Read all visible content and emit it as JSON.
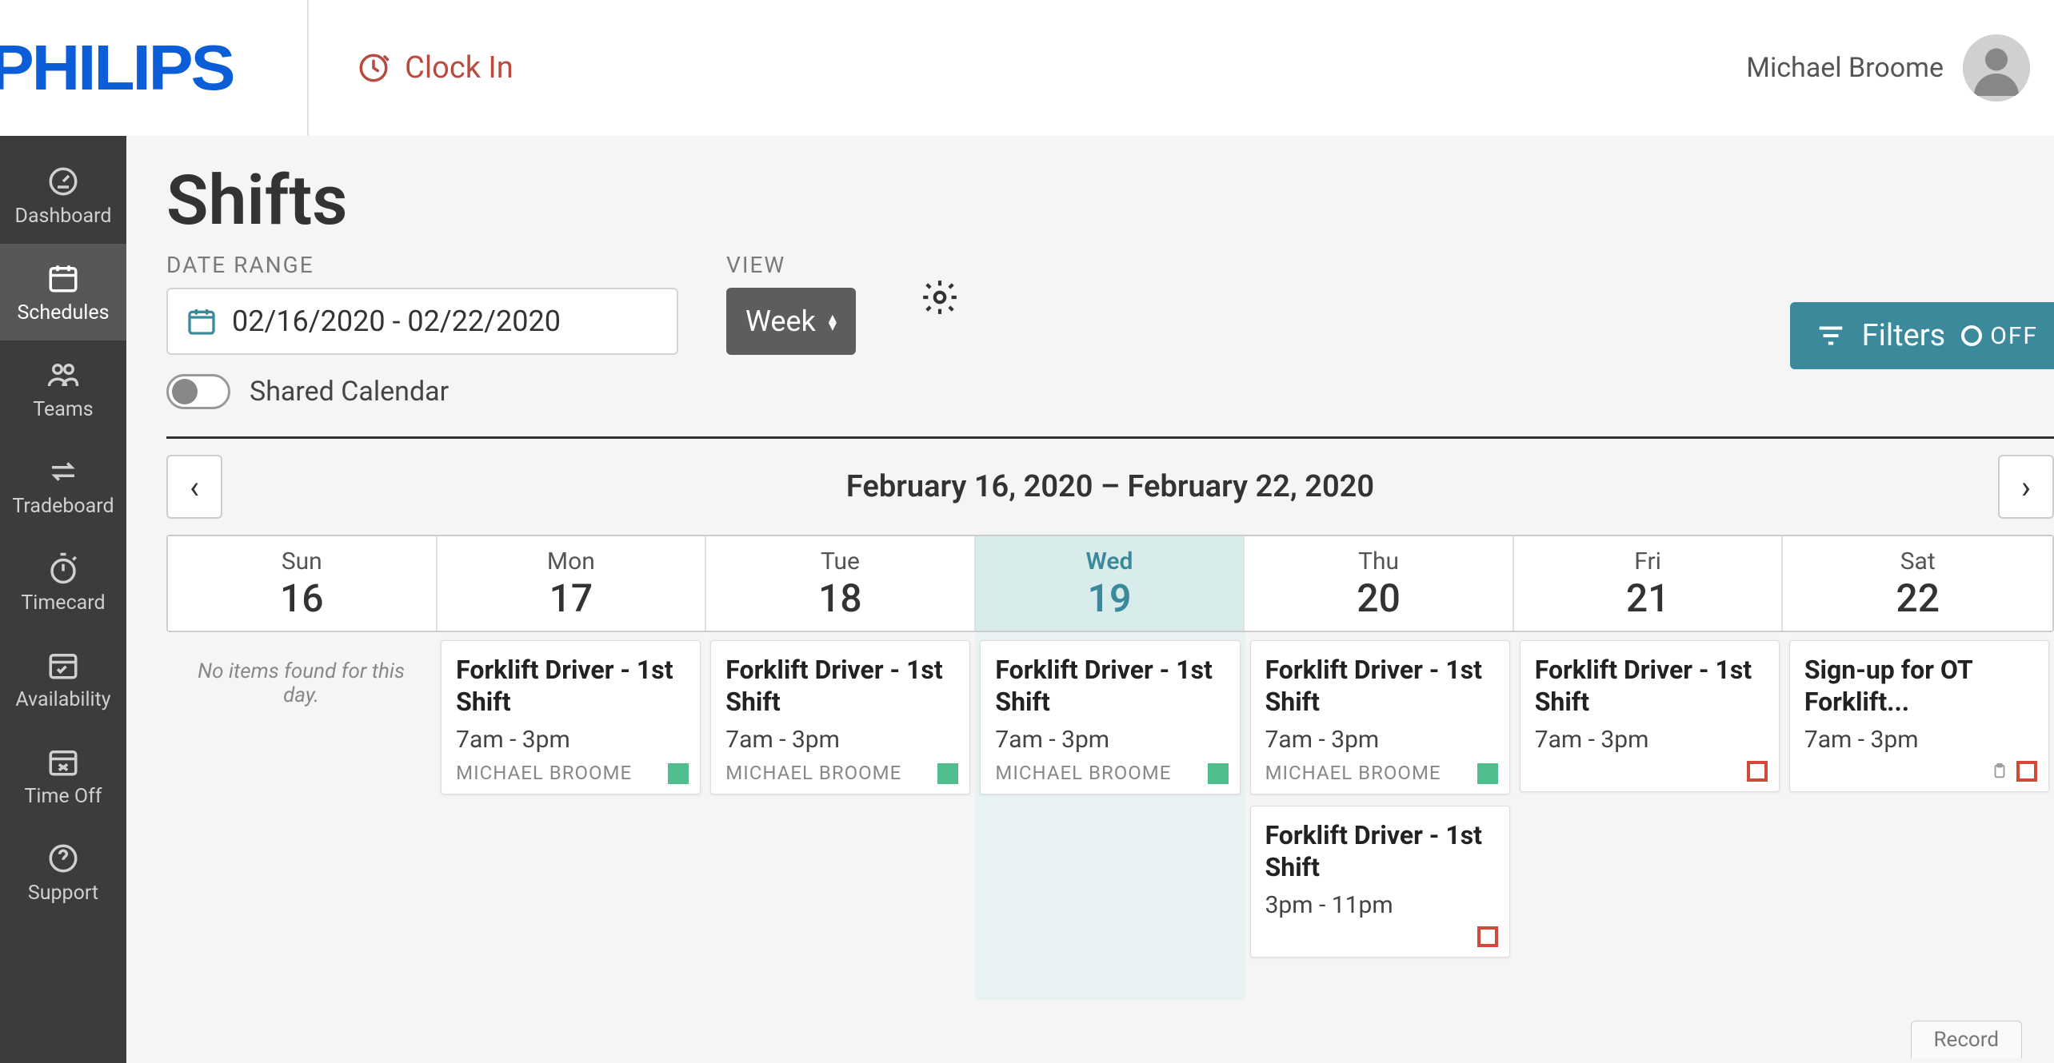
{
  "brand": "PHILIPS",
  "clock_in_label": "Clock In",
  "user_name": "Michael Broome",
  "sidebar": {
    "items": [
      {
        "id": "dashboard",
        "label": "Dashboard",
        "icon": "gauge"
      },
      {
        "id": "schedules",
        "label": "Schedules",
        "icon": "calendar",
        "active": true
      },
      {
        "id": "teams",
        "label": "Teams",
        "icon": "people"
      },
      {
        "id": "tradeboard",
        "label": "Tradeboard",
        "icon": "swap"
      },
      {
        "id": "timecard",
        "label": "Timecard",
        "icon": "stopwatch"
      },
      {
        "id": "availability",
        "label": "Availability",
        "icon": "cal-check"
      },
      {
        "id": "timeoff",
        "label": "Time Off",
        "icon": "cal-x"
      },
      {
        "id": "support",
        "label": "Support",
        "icon": "help"
      }
    ]
  },
  "page": {
    "title": "Shifts",
    "date_range_label": "DATE RANGE",
    "date_range_value": "02/16/2020 - 02/22/2020",
    "view_label": "VIEW",
    "view_value": "Week",
    "shared_calendar_label": "Shared Calendar",
    "shared_calendar_on": false,
    "filters_label": "Filters",
    "filters_state": "OFF"
  },
  "calendar": {
    "range_label": "February 16, 2020 – February 22, 2020",
    "empty_message": "No items found for this day.",
    "days": [
      {
        "dow": "Sun",
        "num": "16",
        "today": false
      },
      {
        "dow": "Mon",
        "num": "17",
        "today": false
      },
      {
        "dow": "Tue",
        "num": "18",
        "today": false
      },
      {
        "dow": "Wed",
        "num": "19",
        "today": true
      },
      {
        "dow": "Thu",
        "num": "20",
        "today": false
      },
      {
        "dow": "Fri",
        "num": "21",
        "today": false
      },
      {
        "dow": "Sat",
        "num": "22",
        "today": false
      }
    ],
    "columns": [
      {
        "empty": true
      },
      {
        "shifts": [
          {
            "title": "Forklift Driver - 1st Shift",
            "time": "7am - 3pm",
            "person": "MICHAEL BROOME",
            "status": "green"
          }
        ]
      },
      {
        "shifts": [
          {
            "title": "Forklift Driver - 1st Shift",
            "time": "7am - 3pm",
            "person": "MICHAEL BROOME",
            "status": "green"
          }
        ]
      },
      {
        "shifts": [
          {
            "title": "Forklift Driver - 1st Shift",
            "time": "7am - 3pm",
            "person": "MICHAEL BROOME",
            "status": "green"
          }
        ]
      },
      {
        "shifts": [
          {
            "title": "Forklift Driver - 1st Shift",
            "time": "7am - 3pm",
            "person": "MICHAEL BROOME",
            "status": "green"
          },
          {
            "title": "Forklift Driver - 1st Shift",
            "time": "3pm - 11pm",
            "person": "",
            "status": "red"
          }
        ]
      },
      {
        "shifts": [
          {
            "title": "Forklift Driver - 1st Shift",
            "time": "7am - 3pm",
            "person": "",
            "status": "red"
          }
        ]
      },
      {
        "shifts": [
          {
            "title": "Sign-up for OT Forklift...",
            "time": "7am - 3pm",
            "person": "",
            "status": "red",
            "clipboard": true
          }
        ]
      }
    ]
  },
  "record_label": "Record",
  "colors": {
    "accent": "#3a8a9c",
    "brand_blue": "#0b5ed7",
    "sidebar_bg": "#3b3c3e",
    "green": "#4fc08d",
    "red": "#d04a3a"
  }
}
